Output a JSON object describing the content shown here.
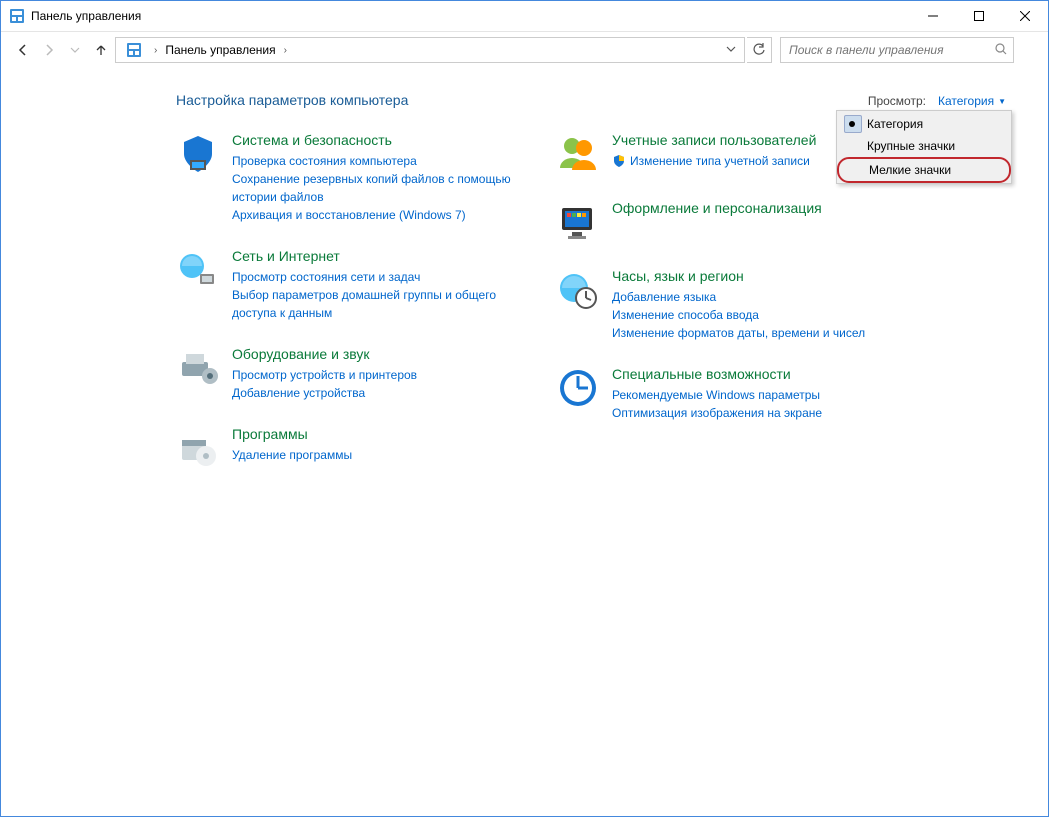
{
  "window": {
    "title": "Панель управления"
  },
  "nav": {
    "breadcrumb_root": "Панель управления",
    "search_placeholder": "Поиск в панели управления"
  },
  "page": {
    "heading": "Настройка параметров компьютера",
    "view_label": "Просмотр:",
    "view_value": "Категория"
  },
  "view_menu": {
    "items": [
      {
        "label": "Категория",
        "selected": true
      },
      {
        "label": "Крупные значки",
        "selected": false
      },
      {
        "label": "Мелкие значки",
        "selected": false,
        "highlighted": true
      }
    ]
  },
  "cats_left": [
    {
      "name": "system-security",
      "title": "Система и безопасность",
      "links": [
        "Проверка состояния компьютера",
        "Сохранение резервных копий файлов с помощью истории файлов",
        "Архивация и восстановление (Windows 7)"
      ]
    },
    {
      "name": "network-internet",
      "title": "Сеть и Интернет",
      "links": [
        "Просмотр состояния сети и задач",
        "Выбор параметров домашней группы и общего доступа к данным"
      ]
    },
    {
      "name": "hardware-sound",
      "title": "Оборудование и звук",
      "links": [
        "Просмотр устройств и принтеров",
        "Добавление устройства"
      ]
    },
    {
      "name": "programs",
      "title": "Программы",
      "links": [
        "Удаление программы"
      ]
    }
  ],
  "cats_right": [
    {
      "name": "user-accounts",
      "title": "Учетные записи пользователей",
      "links": [
        {
          "text": "Изменение типа учетной записи",
          "shield": true
        }
      ]
    },
    {
      "name": "appearance",
      "title": "Оформление и персонализация",
      "links": []
    },
    {
      "name": "clock-region",
      "title": "Часы, язык и регион",
      "links": [
        "Добавление языка",
        "Изменение способа ввода",
        "Изменение форматов даты, времени и чисел"
      ]
    },
    {
      "name": "ease-of-access",
      "title": "Специальные возможности",
      "links": [
        "Рекомендуемые Windows параметры",
        "Оптимизация изображения на экране"
      ]
    }
  ]
}
